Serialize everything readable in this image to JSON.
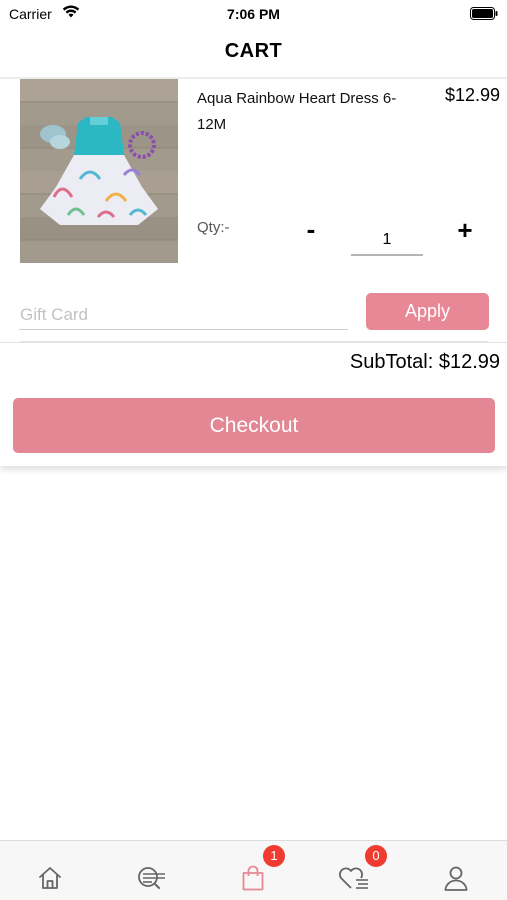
{
  "status_bar": {
    "carrier": "Carrier",
    "time": "7:06 PM"
  },
  "nav": {
    "title": "CART"
  },
  "cart_items": [
    {
      "name": "Aqua Rainbow Heart Dress 6-12M",
      "price": "$12.99",
      "qty_label": "Qty:-",
      "qty": "1",
      "minus": "-",
      "plus": "+"
    }
  ],
  "gift_card": {
    "placeholder": "Gift Card",
    "value": "",
    "apply_label": "Apply"
  },
  "summary": {
    "subtotal": "SubTotal: $12.99",
    "checkout_label": "Checkout"
  },
  "tab_bar": {
    "tabs": [
      {
        "icon": "home-icon",
        "badge": ""
      },
      {
        "icon": "search-list-icon",
        "badge": ""
      },
      {
        "icon": "shopping-bag-icon",
        "badge": "1",
        "active": true
      },
      {
        "icon": "wishlist-heart-icon",
        "badge": "0"
      },
      {
        "icon": "profile-icon",
        "badge": ""
      }
    ]
  },
  "colors": {
    "accent": "#e38794",
    "badge": "#ef3b30",
    "active_tab": "#e88796"
  }
}
